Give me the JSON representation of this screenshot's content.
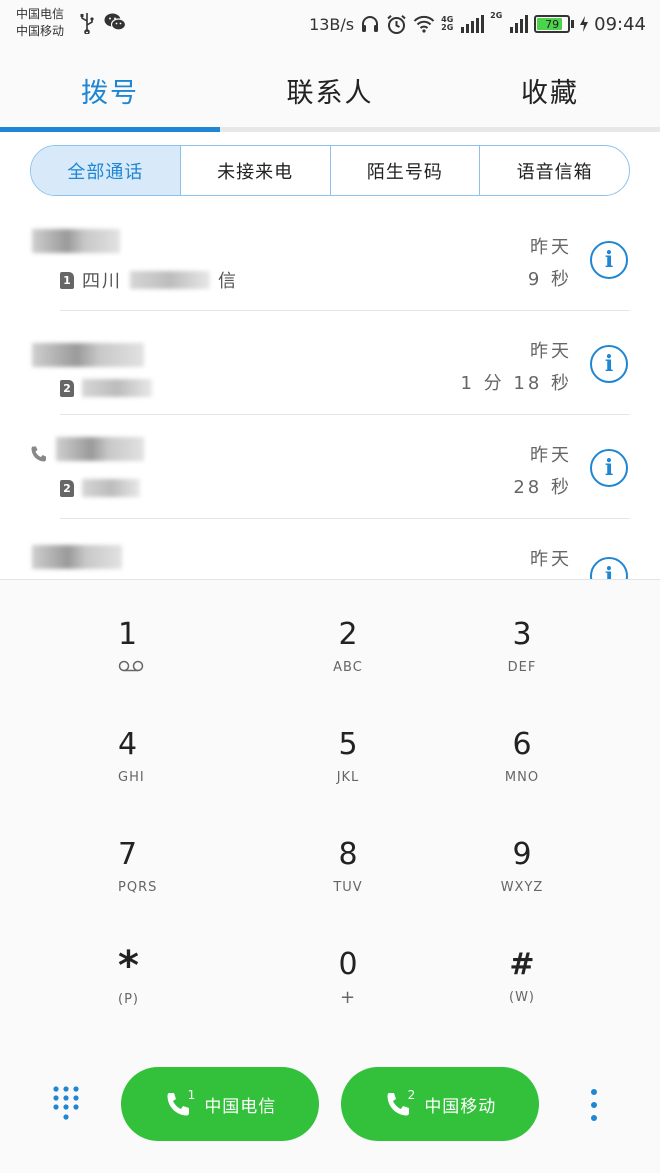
{
  "status_bar": {
    "carrier1": "中国电信",
    "carrier2": "中国移动",
    "net_speed": "13B/s",
    "sig1_label_top": "4G",
    "sig1_label_bottom": "2G",
    "sig2_label": "2G",
    "battery": "79",
    "time": "09:44"
  },
  "tabs": [
    {
      "label": "拨号"
    },
    {
      "label": "联系人"
    },
    {
      "label": "收藏"
    }
  ],
  "filters": [
    {
      "label": "全部通话"
    },
    {
      "label": "未接来电"
    },
    {
      "label": "陌生号码"
    },
    {
      "label": "语音信箱"
    }
  ],
  "calls": [
    {
      "sim": "1",
      "location": "四川",
      "location_tail": "信",
      "when": "昨天",
      "duration": "9 秒"
    },
    {
      "sim": "2",
      "when": "昨天",
      "duration": "1 分 18 秒"
    },
    {
      "sim": "2",
      "when": "昨天",
      "duration": "28 秒"
    },
    {
      "when": "昨天"
    }
  ],
  "dialpad": {
    "keys": [
      {
        "digit": "1",
        "letters": ""
      },
      {
        "digit": "2",
        "letters": "ABC"
      },
      {
        "digit": "3",
        "letters": "DEF"
      },
      {
        "digit": "4",
        "letters": "GHI"
      },
      {
        "digit": "5",
        "letters": "JKL"
      },
      {
        "digit": "6",
        "letters": "MNO"
      },
      {
        "digit": "7",
        "letters": "PQRS"
      },
      {
        "digit": "8",
        "letters": "TUV"
      },
      {
        "digit": "9",
        "letters": "WXYZ"
      },
      {
        "digit": "*",
        "letters": "(P)"
      },
      {
        "digit": "0",
        "letters": "+"
      },
      {
        "digit": "#",
        "letters": "(W)"
      }
    ],
    "call_sim1": {
      "badge": "1",
      "label": "中国电信"
    },
    "call_sim2": {
      "badge": "2",
      "label": "中国移动"
    }
  },
  "colors": {
    "accent": "#1f86d4",
    "call_green": "#33c13c"
  }
}
